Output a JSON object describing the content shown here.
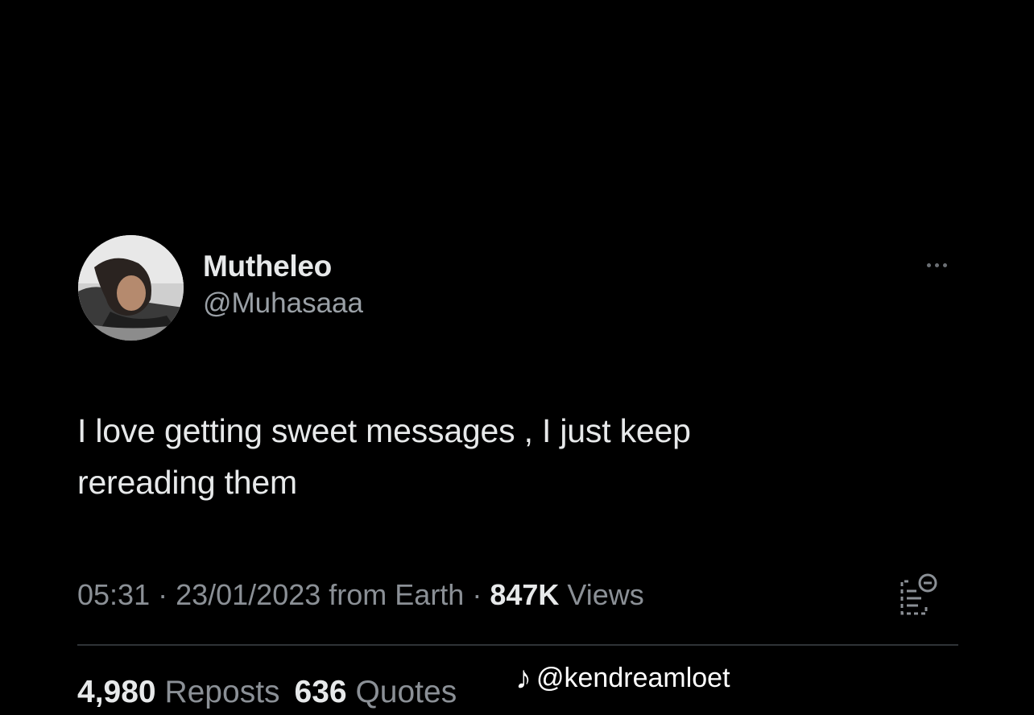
{
  "tweet": {
    "author": {
      "display_name": "Mutheleo",
      "handle": "@Muhasaaa",
      "avatar_icon": "user-photo-avatar"
    },
    "more_icon": "more-horizontal-icon",
    "text_line1": "I love getting sweet messages , I just keep",
    "text_line2": "rereading them",
    "meta": {
      "time": "05:31",
      "separator1": " · ",
      "date": "23/01/2023",
      "source": " from Earth",
      "separator2": " · ",
      "views_count": "847K",
      "views_label": " Views"
    },
    "analytics_icon": "view-analytics-icon",
    "stats": {
      "reposts_count": "4,980",
      "reposts_label": "Reposts",
      "quotes_count": "636",
      "quotes_label": "Quotes"
    }
  },
  "watermark": {
    "icon": "tiktok-icon",
    "text": "@kendreamloet"
  },
  "colors": {
    "background": "#000000",
    "primary_text": "#e7e9ea",
    "secondary_text": "#8b9096",
    "divider": "#2f3336"
  }
}
